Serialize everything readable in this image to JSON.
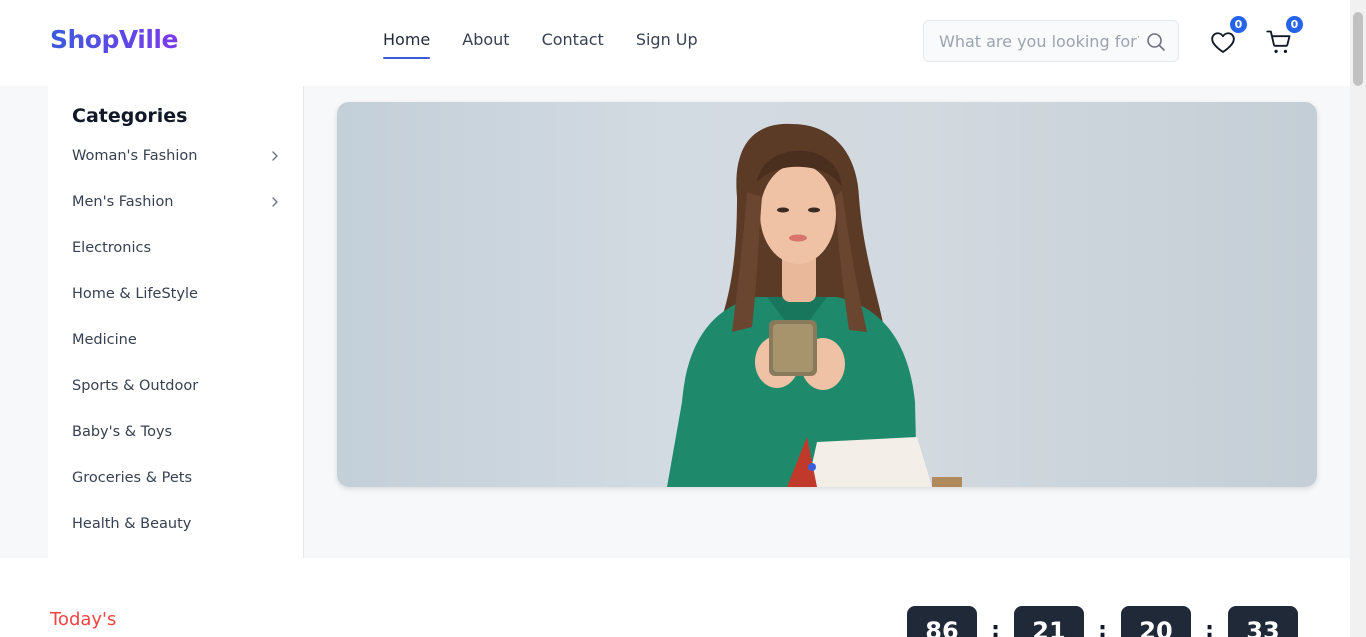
{
  "brand": {
    "name": "ShopVille"
  },
  "nav": {
    "home": "Home",
    "about": "About",
    "contact": "Contact",
    "signup": "Sign Up"
  },
  "search": {
    "placeholder": "What are you looking for?"
  },
  "header": {
    "wishlist_count": "0",
    "cart_count": "0"
  },
  "sidebar": {
    "title": "Categories",
    "items": [
      {
        "label": "Woman's Fashion",
        "has_submenu": true
      },
      {
        "label": "Men's Fashion",
        "has_submenu": true
      },
      {
        "label": "Electronics"
      },
      {
        "label": "Home & LifeStyle"
      },
      {
        "label": "Medicine"
      },
      {
        "label": "Sports & Outdoor"
      },
      {
        "label": "Baby's & Toys"
      },
      {
        "label": "Groceries & Pets"
      },
      {
        "label": "Health & Beauty"
      }
    ]
  },
  "hero": {
    "image": "woman-using-phone-with-shopping-bags",
    "active_slide": 1,
    "slide_count": 1
  },
  "flash_sale": {
    "label": "Today's",
    "countdown": {
      "days": "86",
      "hours": "21",
      "minutes": "20",
      "seconds": "33",
      "separator": ":"
    }
  },
  "colors": {
    "accent": "#3b5bdb",
    "badge": "#2563eb",
    "sale_red": "#ef4444",
    "countdown_bg": "#1f2937"
  }
}
